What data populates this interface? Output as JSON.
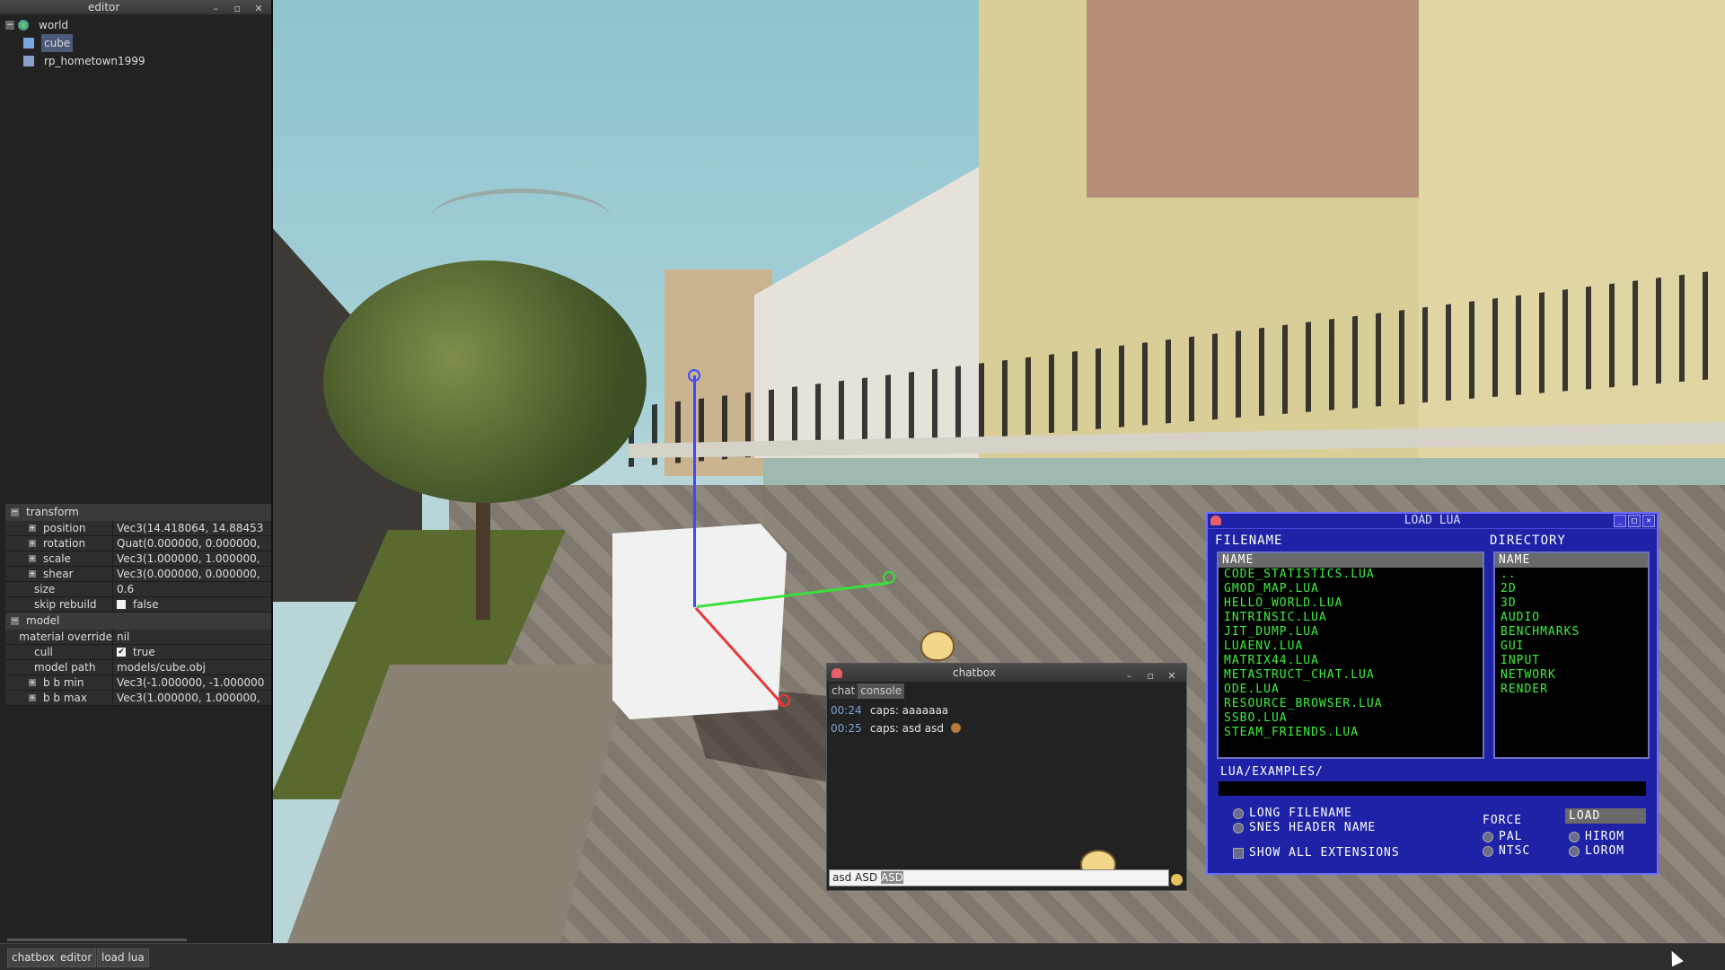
{
  "editor": {
    "title": "editor",
    "tree": [
      {
        "label": "world",
        "expanded": true
      },
      {
        "label": "cube",
        "selected": true
      },
      {
        "label": "rp_hometown1999"
      }
    ],
    "sections": {
      "transform": {
        "label": "transform",
        "rows": [
          {
            "key": "position",
            "value": "Vec3(14.418064, 14.88453"
          },
          {
            "key": "rotation",
            "value": "Quat(0.000000, 0.000000,"
          },
          {
            "key": "scale",
            "value": "Vec3(1.000000, 1.000000,"
          },
          {
            "key": "shear",
            "value": "Vec3(0.000000, 0.000000,"
          },
          {
            "key": "size",
            "value": "0.6"
          },
          {
            "key": "skip rebuild",
            "value": "false"
          }
        ]
      },
      "model": {
        "label": "model",
        "rows": [
          {
            "key": "material override",
            "value": "nil"
          },
          {
            "key": "cull",
            "value": "true"
          },
          {
            "key": "model path",
            "value": "models/cube.obj"
          },
          {
            "key": "b b min",
            "value": "Vec3(-1.000000, -1.000000"
          },
          {
            "key": "b b max",
            "value": "Vec3(1.000000, 1.000000,"
          }
        ]
      }
    }
  },
  "chatbox": {
    "title": "chatbox",
    "tabs": [
      "chat",
      "console"
    ],
    "active_tab": "console",
    "messages": [
      {
        "time": "00:24",
        "text": "caps: aaaaaaa"
      },
      {
        "time": "00:25",
        "text": "caps: asd asd"
      }
    ],
    "input_value": "asd ASD",
    "input_highlight": "ASD"
  },
  "loadlua": {
    "title": "LOAD LUA",
    "filename_label": "FILENAME",
    "directory_label": "DIRECTORY",
    "name_header": "NAME",
    "files": [
      "CODE_STATISTICS.LUA",
      "GMOD_MAP.LUA",
      "HELLO_WORLD.LUA",
      "INTRINSIC.LUA",
      "JIT_DUMP.LUA",
      "LUAENV.LUA",
      "MATRIX44.LUA",
      "METASTRUCT_CHAT.LUA",
      "ODE.LUA",
      "RESOURCE_BROWSER.LUA",
      "SSBO.LUA",
      "STEAM_FRIENDS.LUA"
    ],
    "directories": [
      "..",
      "2D",
      "3D",
      "AUDIO",
      "BENCHMARKS",
      "GUI",
      "INPUT",
      "NETWORK",
      "RENDER"
    ],
    "path": "LUA/EXAMPLES/",
    "options": {
      "long_filename": "LONG FILENAME",
      "snes_header_name": "SNES HEADER NAME",
      "show_all_extensions": "SHOW ALL EXTENSIONS",
      "force": "FORCE",
      "pal": "PAL",
      "ntsc": "NTSC",
      "hirom": "HIROM",
      "lorom": "LOROM",
      "load": "LOAD"
    }
  },
  "taskbar": {
    "items": [
      "chatbox",
      "editor",
      "load lua"
    ]
  },
  "colors": {
    "snes_blue": "#1d22a6",
    "snes_green": "#3cf03c",
    "axis_x": "#e83838",
    "axis_y": "#39e03b",
    "axis_z": "#3b4bff"
  }
}
